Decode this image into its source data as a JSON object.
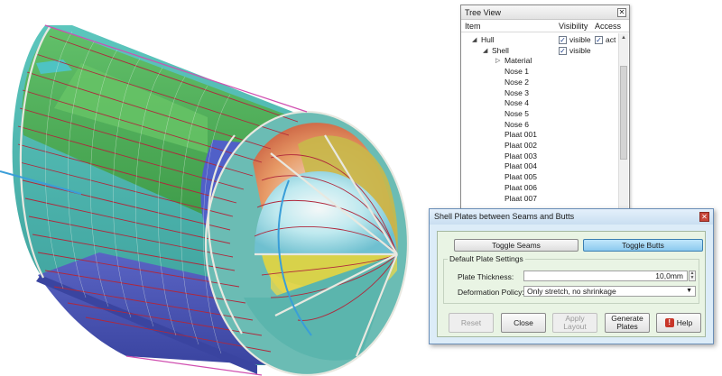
{
  "tree_view": {
    "title": "Tree View",
    "columns": [
      "Item",
      "Visibility",
      "Access"
    ],
    "hull": {
      "label": "Hull",
      "visibility": "visible",
      "access": "act"
    },
    "shell": {
      "label": "Shell",
      "visibility": "visible"
    },
    "material": {
      "label": "Material"
    },
    "items": [
      "Nose 1",
      "Nose 2",
      "Nose 3",
      "Nose 4",
      "Nose 5",
      "Nose 6",
      "Plaat 001",
      "Plaat 002",
      "Plaat 003",
      "Plaat 004",
      "Plaat 005",
      "Plaat 006",
      "Plaat 007"
    ]
  },
  "dialog": {
    "title": "Shell Plates between Seams and Butts",
    "toggle_seams": "Toggle Seams",
    "toggle_butts": "Toggle Butts",
    "group_label": "Default Plate Settings",
    "thickness_label": "Plate Thickness:",
    "thickness_value": "10,0mm",
    "policy_label": "Deformation Policy:",
    "policy_value": "Only stretch, no shrinkage",
    "buttons": {
      "reset": "Reset",
      "close": "Close",
      "apply_line1": "Apply",
      "apply_line2": "Layout",
      "generate_line1": "Generate",
      "generate_line2": "Plates",
      "help": "Help"
    }
  },
  "icons": {
    "close": "close-icon",
    "expand": "triangle-expanded-icon",
    "collapsed": "triangle-collapsed-icon",
    "help": "help-icon"
  },
  "colors": {
    "plate_green": "#4fb35a",
    "plate_teal": "#4fb8b0",
    "plate_blue": "#4a58b8",
    "seam_red": "#b0283c",
    "seam_white": "#e0e0d8",
    "dialog_bg": "#dcecf8",
    "dialog_inner": "#e9f4e4",
    "toggle_active": "#8cc9ef"
  }
}
